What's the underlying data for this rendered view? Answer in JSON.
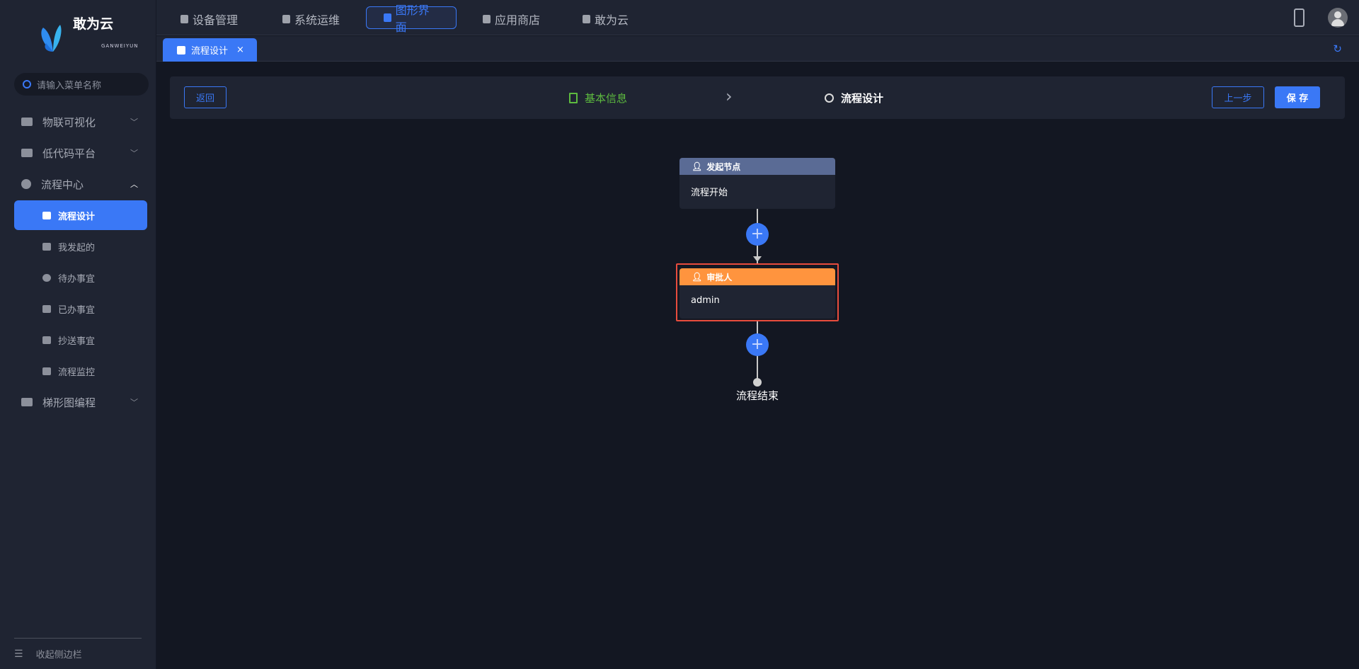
{
  "brand": {
    "name": "敢为云",
    "sub": "GANWEIYUN"
  },
  "sidebar": {
    "search_placeholder": "请输入菜单名称",
    "menus": [
      {
        "label": "物联可视化"
      },
      {
        "label": "低代码平台"
      },
      {
        "label": "流程中心"
      },
      {
        "label": "梯形图编程"
      }
    ],
    "sub_items": [
      {
        "label": "流程设计"
      },
      {
        "label": "我发起的"
      },
      {
        "label": "待办事宜"
      },
      {
        "label": "已办事宜"
      },
      {
        "label": "抄送事宜"
      },
      {
        "label": "流程监控"
      }
    ],
    "collapse": "收起侧边栏"
  },
  "topnav": [
    {
      "label": "设备管理"
    },
    {
      "label": "系统运维"
    },
    {
      "label": "图形界面"
    },
    {
      "label": "应用商店"
    },
    {
      "label": "敢为云"
    }
  ],
  "tabs": [
    {
      "label": "流程设计",
      "close": "×"
    }
  ],
  "steps": {
    "back": "返回",
    "step1": "基本信息",
    "step2": "流程设计",
    "prev": "上一步",
    "save": "保 存"
  },
  "flow": {
    "start_title": "发起节点",
    "start_body": "流程开始",
    "approver_title": "审批人",
    "approver_body": "admin",
    "end": "流程结束"
  },
  "colors": {
    "accent": "#3a78f6",
    "start_header": "#5a6b95",
    "approver_header": "#ff943e",
    "selected_border": "#e84c3d",
    "step_done": "#5dbb3f"
  }
}
